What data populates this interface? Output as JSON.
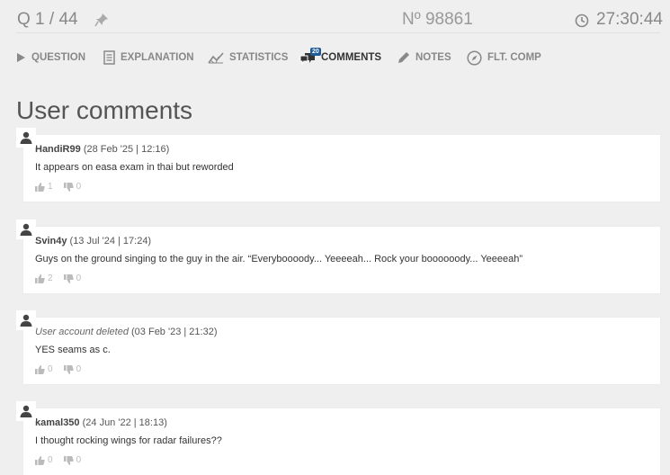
{
  "header": {
    "counter": "Q 1 / 44",
    "question_number": "Nº 98861",
    "timer": "27:30:44"
  },
  "tabs": [
    {
      "label": "QUESTION",
      "icon": "play-icon"
    },
    {
      "label": "EXPLANATION",
      "icon": "document-icon"
    },
    {
      "label": "STATISTICS",
      "icon": "chart-line-icon"
    },
    {
      "label": "COMMENTS",
      "icon": "comments-icon",
      "badge": "20",
      "active": true
    },
    {
      "label": "NOTES",
      "icon": "pencil-icon"
    },
    {
      "label": "FLT. COMP",
      "icon": "compass-icon"
    }
  ],
  "heading": "User comments",
  "comments": [
    {
      "author": "HandiR99",
      "date": "(28 Feb '25 | 12:16)",
      "text": "It appears on easa exam in thai but reworded",
      "likes": "1",
      "dislikes": "0"
    },
    {
      "author": "Svin4y",
      "date": "(13 Jul '24 | 17:24)",
      "text": "Guys on the ground singing to the guy in the air. “Everyboooody... Yeeeeah... Rock your boooooody... Yeeeeah”",
      "likes": "2",
      "dislikes": "0"
    },
    {
      "author": "User account deleted",
      "date": "(03 Feb '23 | 21:32)",
      "text": "YES seams as c.",
      "likes": "0",
      "dislikes": "0"
    },
    {
      "author": "kamal350",
      "date": "(24 Jun '22 | 18:13)",
      "text": "I thought rocking wings for radar failures??",
      "likes": "0",
      "dislikes": "0"
    }
  ]
}
